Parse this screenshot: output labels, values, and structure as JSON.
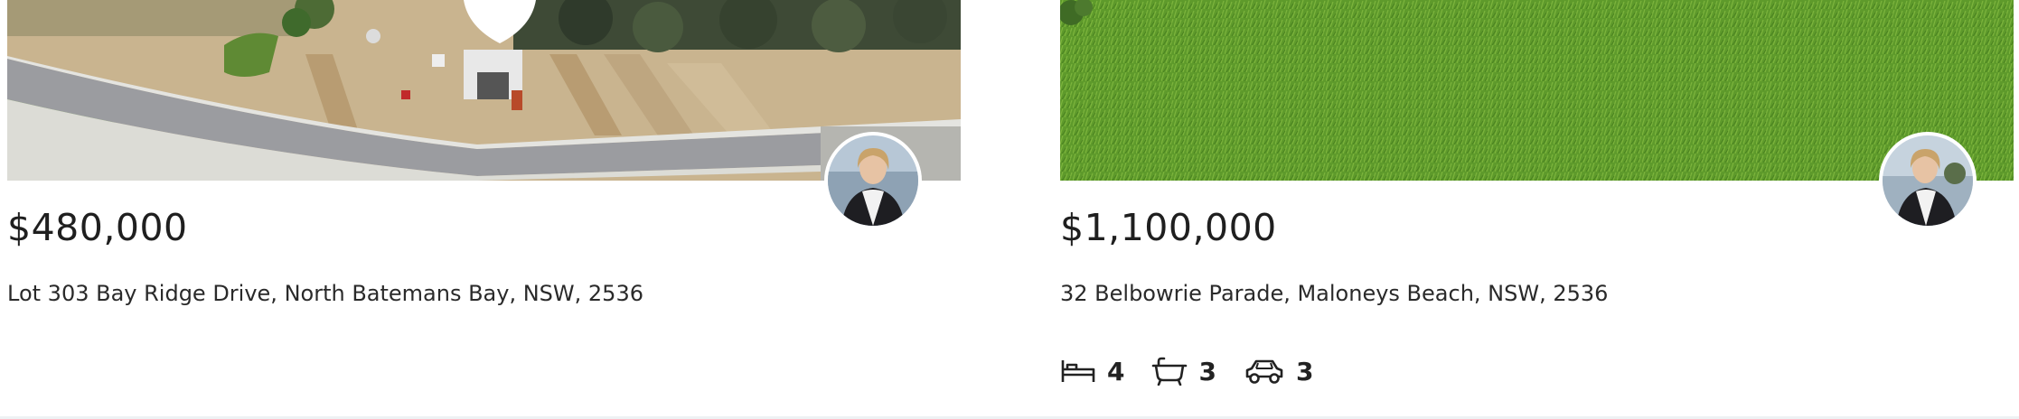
{
  "listings": [
    {
      "price": "$480,000",
      "address": "Lot 303 Bay Ridge Drive, North Batemans Bay, NSW, 2536",
      "photo_icon": "aerial-land-photo",
      "agent_icon": "agent-avatar"
    },
    {
      "price": "$1,100,000",
      "address": "32 Belbowrie Parade, Maloneys Beach, NSW, 2536",
      "photo_icon": "grass-lawn-photo",
      "agent_icon": "agent-avatar",
      "features": {
        "bedrooms": "4",
        "bathrooms": "3",
        "car_spaces": "3",
        "bed_icon": "bed-icon",
        "bath_icon": "bath-icon",
        "car_icon": "car-icon"
      }
    }
  ],
  "colors": {
    "grass": "#5f9a2a",
    "road": "#9a9a9e",
    "dirt": "#c8b08a",
    "text": "#222222"
  }
}
